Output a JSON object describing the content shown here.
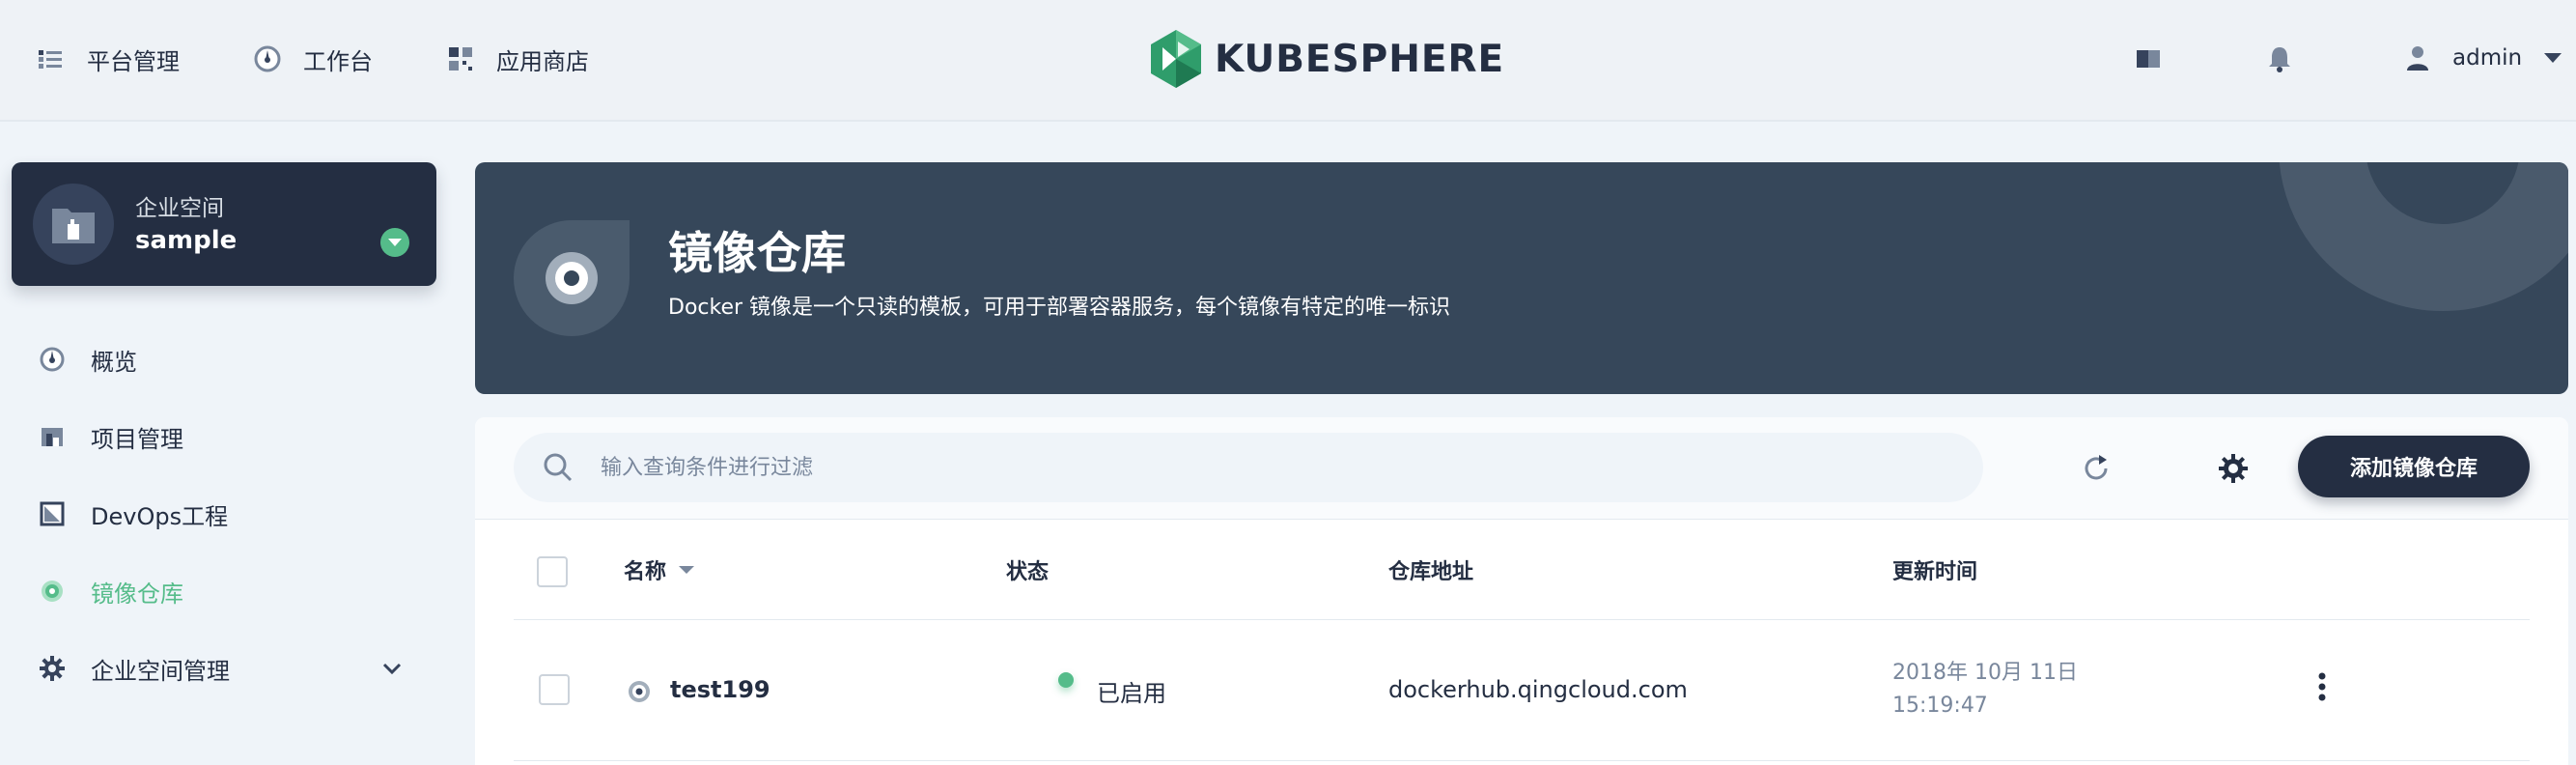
{
  "topnav": {
    "platform": "平台管理",
    "workbench": "工作台",
    "appstore": "应用商店",
    "logo_text": "KUBESPHERE",
    "user": "admin"
  },
  "sidebar": {
    "workspace_type": "企业空间",
    "workspace_name": "sample",
    "items": [
      {
        "label": "概览",
        "icon": "dashboard-icon"
      },
      {
        "label": "项目管理",
        "icon": "project-icon"
      },
      {
        "label": "DevOps工程",
        "icon": "devops-icon"
      },
      {
        "label": "镜像仓库",
        "icon": "image-registry-icon",
        "active": true
      },
      {
        "label": "企业空间管理",
        "icon": "gear-icon"
      }
    ]
  },
  "banner": {
    "title": "镜像仓库",
    "description": "Docker 镜像是一个只读的模板，可用于部署容器服务，每个镜像有特定的唯一标识"
  },
  "toolbar": {
    "search_placeholder": "输入查询条件进行过滤",
    "add_button": "添加镜像仓库"
  },
  "table": {
    "columns": [
      "名称",
      "状态",
      "仓库地址",
      "更新时间"
    ],
    "rows": [
      {
        "name": "test199",
        "status": "已启用",
        "address": "dockerhub.qingcloud.com",
        "updated_date": "2018年 10月 11日",
        "updated_time": "15:19:47"
      }
    ]
  },
  "colors": {
    "brand_dark": "#242e42",
    "accent_green": "#55bc8a",
    "banner_bg": "#36475a"
  }
}
